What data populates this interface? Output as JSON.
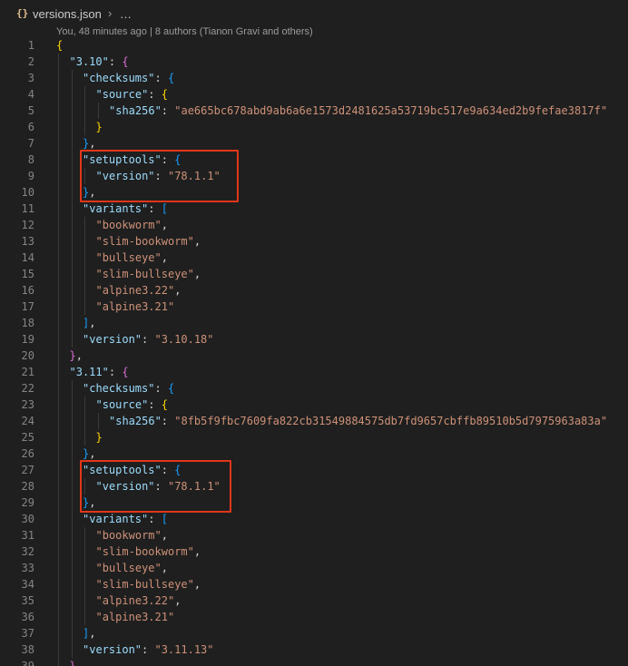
{
  "breadcrumb": {
    "file_icon": "{}",
    "file_name": "versions.json",
    "separator": "›",
    "more": "…"
  },
  "blame": "You, 48 minutes ago | 8 authors (Tianon Gravi and others)",
  "colors": {
    "highlight_border": "#e2361b",
    "key": "#9cdcfe",
    "string": "#ce9178"
  },
  "lines": [
    [
      {
        "t": "{",
        "c": "b1"
      }
    ],
    [
      {
        "t": "\"3.10\"",
        "c": "k"
      },
      {
        "t": ": ",
        "c": "p"
      },
      {
        "t": "{",
        "c": "b2"
      }
    ],
    [
      {
        "t": "\"checksums\"",
        "c": "k"
      },
      {
        "t": ": ",
        "c": "p"
      },
      {
        "t": "{",
        "c": "b3"
      }
    ],
    [
      {
        "t": "\"source\"",
        "c": "k"
      },
      {
        "t": ": ",
        "c": "p"
      },
      {
        "t": "{",
        "c": "b1"
      }
    ],
    [
      {
        "t": "\"sha256\"",
        "c": "k"
      },
      {
        "t": ": ",
        "c": "p"
      },
      {
        "t": "\"ae665bc678abd9ab6a6e1573d2481625a53719bc517e9a634ed2b9fefae3817f\"",
        "c": "s"
      }
    ],
    [
      {
        "t": "}",
        "c": "b1"
      }
    ],
    [
      {
        "t": "}",
        "c": "b3"
      },
      {
        "t": ",",
        "c": "p"
      }
    ],
    [
      {
        "t": "\"setuptools\"",
        "c": "k"
      },
      {
        "t": ": ",
        "c": "p"
      },
      {
        "t": "{",
        "c": "b3"
      }
    ],
    [
      {
        "t": "\"version\"",
        "c": "k"
      },
      {
        "t": ": ",
        "c": "p"
      },
      {
        "t": "\"78.1.1\"",
        "c": "s"
      }
    ],
    [
      {
        "t": "}",
        "c": "b3"
      },
      {
        "t": ",",
        "c": "p"
      }
    ],
    [
      {
        "t": "\"variants\"",
        "c": "k"
      },
      {
        "t": ": ",
        "c": "p"
      },
      {
        "t": "[",
        "c": "b3"
      }
    ],
    [
      {
        "t": "\"bookworm\"",
        "c": "s"
      },
      {
        "t": ",",
        "c": "p"
      }
    ],
    [
      {
        "t": "\"slim-bookworm\"",
        "c": "s"
      },
      {
        "t": ",",
        "c": "p"
      }
    ],
    [
      {
        "t": "\"bullseye\"",
        "c": "s"
      },
      {
        "t": ",",
        "c": "p"
      }
    ],
    [
      {
        "t": "\"slim-bullseye\"",
        "c": "s"
      },
      {
        "t": ",",
        "c": "p"
      }
    ],
    [
      {
        "t": "\"alpine3.22\"",
        "c": "s"
      },
      {
        "t": ",",
        "c": "p"
      }
    ],
    [
      {
        "t": "\"alpine3.21\"",
        "c": "s"
      }
    ],
    [
      {
        "t": "]",
        "c": "b3"
      },
      {
        "t": ",",
        "c": "p"
      }
    ],
    [
      {
        "t": "\"version\"",
        "c": "k"
      },
      {
        "t": ": ",
        "c": "p"
      },
      {
        "t": "\"3.10.18\"",
        "c": "s"
      }
    ],
    [
      {
        "t": "}",
        "c": "b2"
      },
      {
        "t": ",",
        "c": "p"
      }
    ],
    [
      {
        "t": "\"3.11\"",
        "c": "k"
      },
      {
        "t": ": ",
        "c": "p"
      },
      {
        "t": "{",
        "c": "b2"
      }
    ],
    [
      {
        "t": "\"checksums\"",
        "c": "k"
      },
      {
        "t": ": ",
        "c": "p"
      },
      {
        "t": "{",
        "c": "b3"
      }
    ],
    [
      {
        "t": "\"source\"",
        "c": "k"
      },
      {
        "t": ": ",
        "c": "p"
      },
      {
        "t": "{",
        "c": "b1"
      }
    ],
    [
      {
        "t": "\"sha256\"",
        "c": "k"
      },
      {
        "t": ": ",
        "c": "p"
      },
      {
        "t": "\"8fb5f9fbc7609fa822cb31549884575db7fd9657cbffb89510b5d7975963a83a\"",
        "c": "s"
      }
    ],
    [
      {
        "t": "}",
        "c": "b1"
      }
    ],
    [
      {
        "t": "}",
        "c": "b3"
      },
      {
        "t": ",",
        "c": "p"
      }
    ],
    [
      {
        "t": "\"setuptools\"",
        "c": "k"
      },
      {
        "t": ": ",
        "c": "p"
      },
      {
        "t": "{",
        "c": "b3"
      }
    ],
    [
      {
        "t": "\"version\"",
        "c": "k"
      },
      {
        "t": ": ",
        "c": "p"
      },
      {
        "t": "\"78.1.1\"",
        "c": "s"
      }
    ],
    [
      {
        "t": "}",
        "c": "b3"
      },
      {
        "t": ",",
        "c": "p"
      }
    ],
    [
      {
        "t": "\"variants\"",
        "c": "k"
      },
      {
        "t": ": ",
        "c": "p"
      },
      {
        "t": "[",
        "c": "b3"
      }
    ],
    [
      {
        "t": "\"bookworm\"",
        "c": "s"
      },
      {
        "t": ",",
        "c": "p"
      }
    ],
    [
      {
        "t": "\"slim-bookworm\"",
        "c": "s"
      },
      {
        "t": ",",
        "c": "p"
      }
    ],
    [
      {
        "t": "\"bullseye\"",
        "c": "s"
      },
      {
        "t": ",",
        "c": "p"
      }
    ],
    [
      {
        "t": "\"slim-bullseye\"",
        "c": "s"
      },
      {
        "t": ",",
        "c": "p"
      }
    ],
    [
      {
        "t": "\"alpine3.22\"",
        "c": "s"
      },
      {
        "t": ",",
        "c": "p"
      }
    ],
    [
      {
        "t": "\"alpine3.21\"",
        "c": "s"
      }
    ],
    [
      {
        "t": "]",
        "c": "b3"
      },
      {
        "t": ",",
        "c": "p"
      }
    ],
    [
      {
        "t": "\"version\"",
        "c": "k"
      },
      {
        "t": ": ",
        "c": "p"
      },
      {
        "t": "\"3.11.13\"",
        "c": "s"
      }
    ],
    [
      {
        "t": "}",
        "c": "b2"
      },
      {
        "t": ",",
        "c": "p"
      }
    ]
  ],
  "highlighted_lines": [
    [
      8,
      10
    ],
    [
      27,
      29
    ]
  ]
}
